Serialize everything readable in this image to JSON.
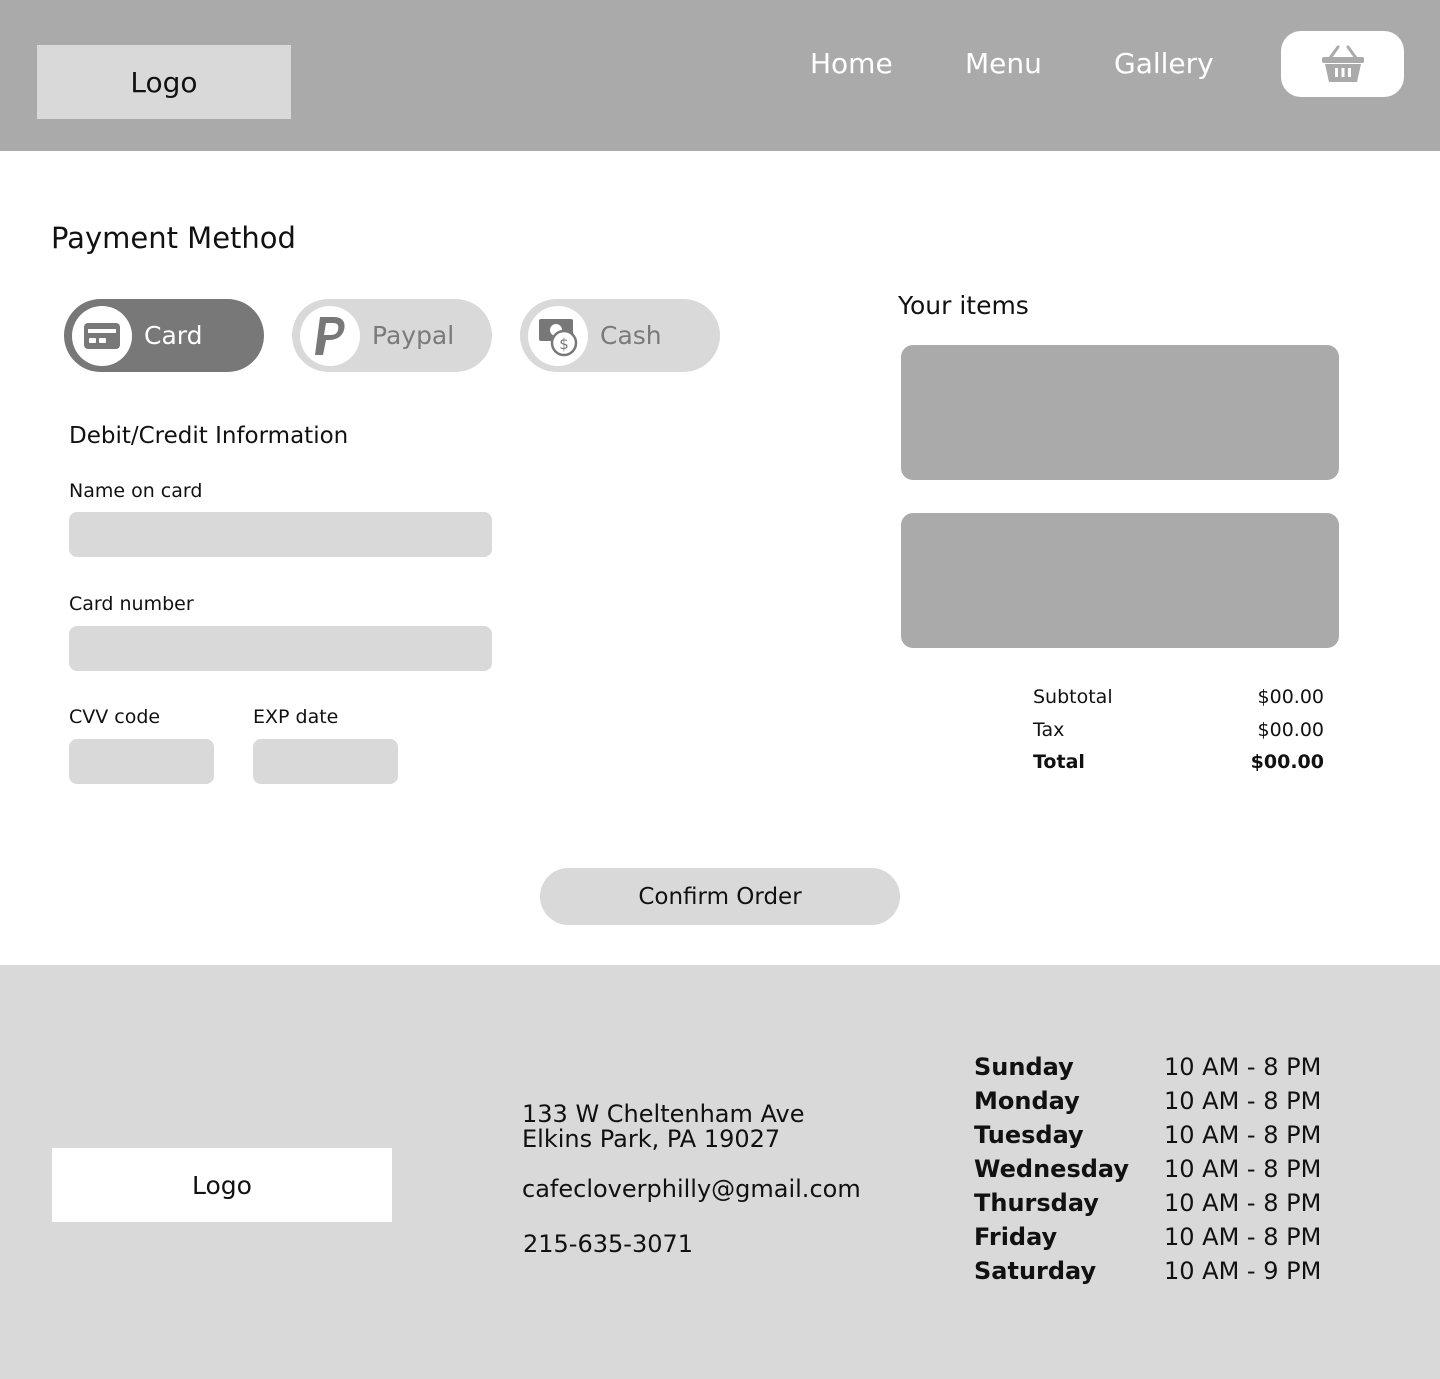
{
  "header": {
    "logo": "Logo",
    "nav": {
      "home": "Home",
      "menu": "Menu",
      "gallery": "Gallery"
    },
    "cart_icon": "basket-icon"
  },
  "payment": {
    "title": "Payment Method",
    "methods": [
      {
        "label": "Card",
        "icon": "credit-card-icon",
        "active": true
      },
      {
        "label": "Paypal",
        "icon": "paypal-icon",
        "active": false
      },
      {
        "label": "Cash",
        "icon": "cash-icon",
        "active": false
      }
    ],
    "form": {
      "title": "Debit/Credit Information",
      "name_label": "Name on card",
      "name_value": "",
      "number_label": "Card number",
      "number_value": "",
      "cvv_label": "CVV code",
      "cvv_value": "",
      "exp_label": "EXP date",
      "exp_value": ""
    }
  },
  "cart": {
    "title": "Your items",
    "summary": {
      "subtotal_label": "Subtotal",
      "subtotal_value": "$00.00",
      "tax_label": "Tax",
      "tax_value": "$00.00",
      "total_label": "Total",
      "total_value": "$00.00"
    }
  },
  "confirm_label": "Confirm Order",
  "footer": {
    "logo": "Logo",
    "address_line1": "133 W Cheltenham Ave",
    "address_line2": "Elkins Park, PA 19027",
    "email": "cafecloverphilly@gmail.com",
    "phone": "215-635-3071",
    "hours": [
      {
        "day": "Sunday",
        "time": "10 AM - 8 PM"
      },
      {
        "day": "Monday",
        "time": "10 AM - 8 PM"
      },
      {
        "day": "Tuesday",
        "time": "10 AM - 8 PM"
      },
      {
        "day": "Wednesday",
        "time": "10 AM - 8 PM"
      },
      {
        "day": "Thursday",
        "time": "10 AM - 8 PM"
      },
      {
        "day": "Friday",
        "time": "10 AM - 8 PM"
      },
      {
        "day": "Saturday",
        "time": "10 AM - 9 PM"
      }
    ]
  },
  "colors": {
    "header_bg": "#aaaaaa",
    "light_gray": "#d9d9d9",
    "active_method": "#787878",
    "item_box": "#aaaaaa"
  }
}
